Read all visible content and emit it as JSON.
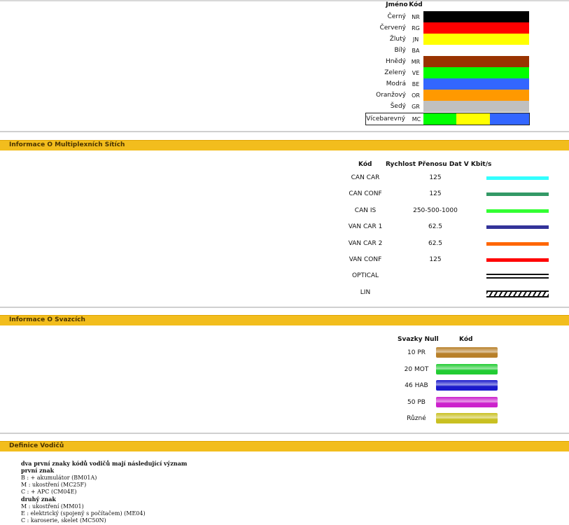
{
  "color_table": {
    "header_name": "Jméno",
    "header_code": "Kód",
    "rows": [
      {
        "name": "Černý",
        "code": "NR",
        "color": "#000000"
      },
      {
        "name": "Červený",
        "code": "RG",
        "color": "#ff0000"
      },
      {
        "name": "Žlutý",
        "code": "JN",
        "color": "#ffff00"
      },
      {
        "name": "Bílý",
        "code": "BA",
        "color": "#ffffff"
      },
      {
        "name": "Hnědý",
        "code": "MR",
        "color": "#993300"
      },
      {
        "name": "Zelený",
        "code": "VE",
        "color": "#00ff00"
      },
      {
        "name": "Modrá",
        "code": "BE",
        "color": "#3366ff"
      },
      {
        "name": "Oranžový",
        "code": "OR",
        "color": "#ff9900"
      },
      {
        "name": "Šedý",
        "code": "GR",
        "color": "#c0c0c0"
      }
    ],
    "multi": {
      "name": "Vícebarevný",
      "code": "MC",
      "colors": [
        "#00ff00",
        "#ffff00",
        "#3366ff"
      ]
    }
  },
  "multiplex": {
    "title": "Informace O Multiplexních Sítích",
    "header_code": "Kód",
    "header_speed": "Rychlost Přenosu Dat V Kbit/s",
    "rows": [
      {
        "name": "CAN CAR",
        "speed": "125",
        "color": "#33ffff",
        "style": "solid"
      },
      {
        "name": "CAN CONF",
        "speed": "125",
        "color": "#339966",
        "style": "solid"
      },
      {
        "name": "CAN IS",
        "speed": "250-500-1000",
        "color": "#33ff33",
        "style": "solid"
      },
      {
        "name": "VAN CAR 1",
        "speed": "62.5",
        "color": "#333399",
        "style": "solid"
      },
      {
        "name": "VAN CAR 2",
        "speed": "62.5",
        "color": "#ff6600",
        "style": "solid"
      },
      {
        "name": "VAN CONF",
        "speed": "125",
        "color": "#ff0000",
        "style": "solid"
      },
      {
        "name": "OPTICAL",
        "speed": "",
        "color": "#111111",
        "style": "double"
      },
      {
        "name": "LIN",
        "speed": "",
        "color": "#111111",
        "style": "hatched"
      }
    ]
  },
  "bundles": {
    "title": "Informace O Svazcích",
    "header_name": "Svazky Null",
    "header_code": "Kód",
    "rows": [
      {
        "name": "10 PR",
        "color": "#b8802a"
      },
      {
        "name": "20 MOT",
        "color": "#22cc33"
      },
      {
        "name": "46 HAB",
        "color": "#1a1acc"
      },
      {
        "name": "50 PB",
        "color": "#cc22cc"
      },
      {
        "name": "Různé",
        "color": "#c9c022"
      }
    ]
  },
  "definitions": {
    "title": "Definice Vodičů",
    "intro": "dva první znaky kódů vodičů mají následující význam",
    "first_label": "první znak",
    "first": [
      "B : + akumulátor   (BM01A)",
      "M : ukostření   (MC25F)",
      "C : + APC  (CM04E)"
    ],
    "second_label": "druhý znak",
    "second": [
      "M : ukostření   (MM01)",
      "E : elektrický (spojený s počítačem)  (ME04)",
      "C : karoserie, skelet  (MC50N)"
    ]
  }
}
